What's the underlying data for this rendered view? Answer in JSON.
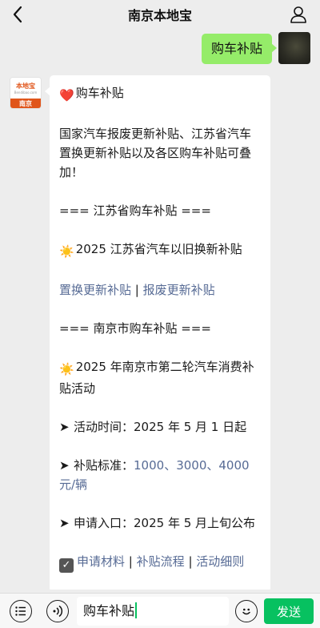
{
  "header": {
    "title": "南京本地宝"
  },
  "outgoing": {
    "text": "购车补贴"
  },
  "incoming": {
    "avatar": {
      "name": "本地宝",
      "url": "Bendibao.com",
      "city": "南京"
    },
    "heart_emoji": "❤️",
    "heading": "购车补贴",
    "intro": "国家汽车报废更新补贴、江苏省汽车置换更新补贴以及各区购车补贴可叠加！",
    "section_jiangsu": "=== 江苏省购车补贴 ===",
    "sun_emoji": "☀️",
    "jiangsu_item": "2025 江苏省汽车以旧换新补贴",
    "links_1": [
      "置换更新补贴",
      "报废更新补贴"
    ],
    "separator": "|",
    "section_nanjing": "=== 南京市购车补贴 ===",
    "nanjing_item": "2025 年南京市第二轮汽车消费补贴活动",
    "arrow": "➤",
    "time_label": "活动时间：",
    "time_value": "2025 年 5 月 1 日起",
    "standard_label": "补贴标准：",
    "standard_value": "1000、3000、4000 元/辆",
    "apply_label": "申请入口：",
    "apply_value": "2025 年 5 月上旬公布",
    "check_mark": "✓",
    "links_2": [
      "申请材料",
      "补贴流程",
      "活动细则"
    ]
  },
  "input_bar": {
    "value": "购车补贴",
    "send_label": "发送"
  },
  "colors": {
    "outgoing_bubble": "#95ec69",
    "link": "#576b95",
    "send_button": "#07c160",
    "brand": "#e0551a"
  },
  "icons": {
    "back": "chevron-left-icon",
    "profile": "person-icon",
    "menu": "list-icon",
    "voice": "voice-icon",
    "emoji": "smiley-icon"
  }
}
